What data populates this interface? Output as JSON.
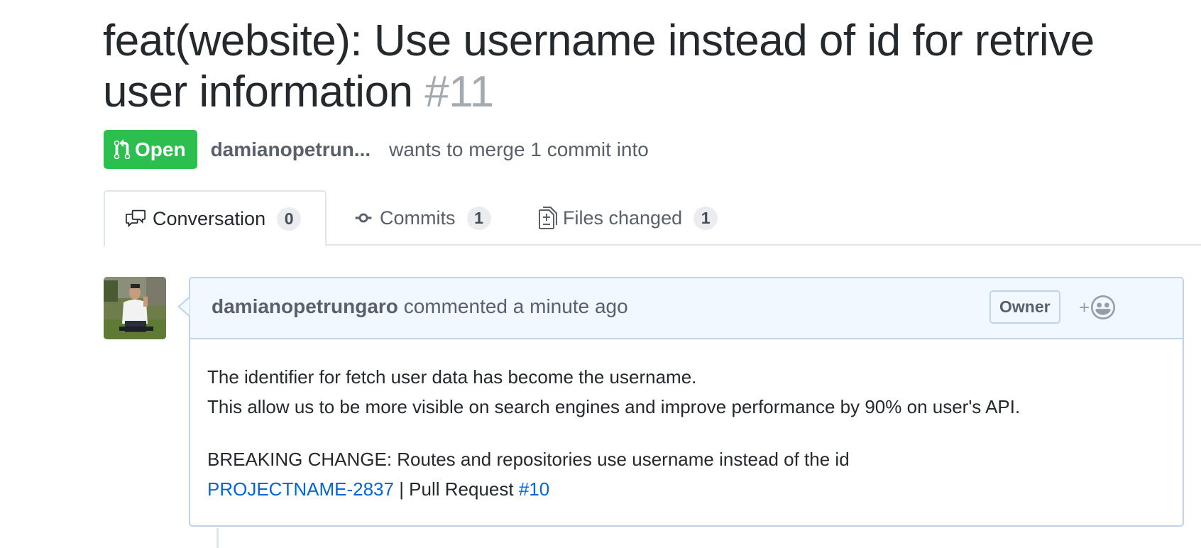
{
  "pull_request": {
    "title": "feat(website): Use username instead of id for retrive user information",
    "number": "#11",
    "state": "Open",
    "author": "damianopetrun...",
    "merge_text": "wants to merge 1 commit into"
  },
  "tabs": [
    {
      "label": "Conversation",
      "count": "0",
      "icon": "comment-discussion-icon",
      "selected": true
    },
    {
      "label": "Commits",
      "count": "1",
      "icon": "git-commit-icon",
      "selected": false
    },
    {
      "label": "Files changed",
      "count": "1",
      "icon": "file-diff-icon",
      "selected": false
    }
  ],
  "comment": {
    "author": "damianopetrungaro",
    "action_text": "commented a minute ago",
    "role_label": "Owner",
    "reaction_plus": "+",
    "body": {
      "line1": "The identifier for fetch user data has become the username.",
      "line2": "This allow us to be more visible on search engines and improve performance by 90% on user's API.",
      "line3": "BREAKING CHANGE: Routes and repositories use username instead of the id",
      "line4_link1": "PROJECTNAME-2837",
      "line4_mid": " | Pull Request ",
      "line4_link2": "#10"
    }
  },
  "colors": {
    "open_badge": "#2cbe4e",
    "link": "#0366d6",
    "comment_header_bg": "#f1f8ff",
    "comment_border": "#c0d3eb"
  }
}
